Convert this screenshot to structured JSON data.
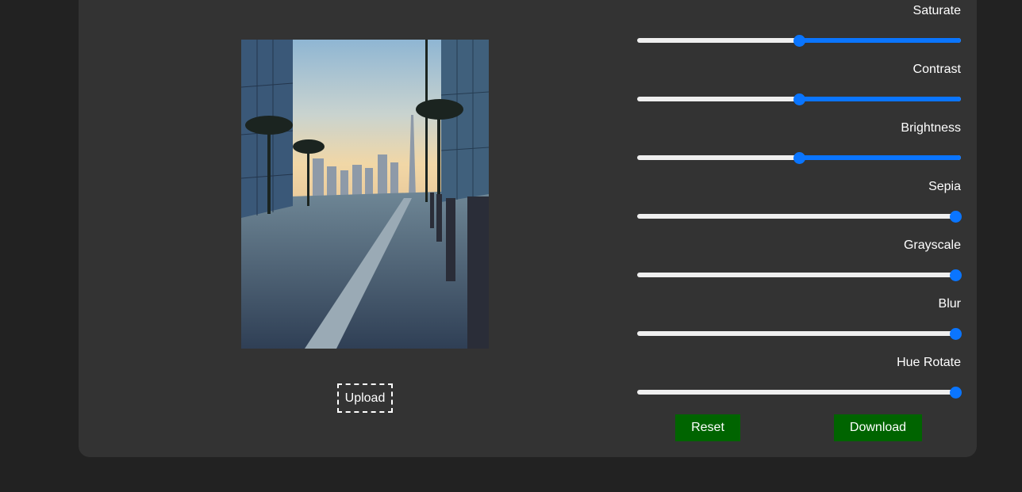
{
  "filters": [
    {
      "label": "Saturate",
      "value": 0.5
    },
    {
      "label": "Contrast",
      "value": 0.5
    },
    {
      "label": "Brightness",
      "value": 0.5
    },
    {
      "label": "Sepia",
      "value": 1.0
    },
    {
      "label": "Grayscale",
      "value": 1.0
    },
    {
      "label": "Blur",
      "value": 1.0
    },
    {
      "label": "Hue Rotate",
      "value": 1.0
    }
  ],
  "upload_label": "Upload",
  "reset_label": "Reset",
  "download_label": "Download",
  "colors": {
    "page_bg": "#222222",
    "panel_bg": "#333333",
    "slider_accent": "#0a75ff",
    "slider_track": "#efefef",
    "button_bg": "#006400"
  }
}
